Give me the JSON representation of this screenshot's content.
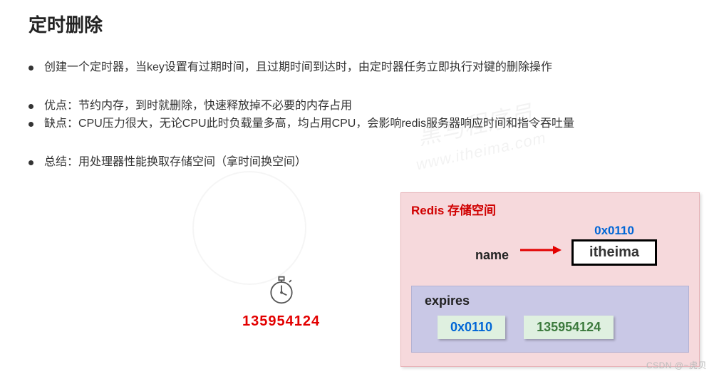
{
  "title": "定时删除",
  "bullets": {
    "b1": "创建一个定时器，当key设置有过期时间，且过期时间到达时，由定时器任务立即执行对键的删除操作",
    "b2": "优点：节约内存，到时就删除，快速释放掉不必要的内存占用",
    "b3": "缺点：CPU压力很大，无论CPU此时负载量多高，均占用CPU，会影响redis服务器响应时间和指令吞吐量",
    "b4": "总结：用处理器性能换取存储空间（拿时间换空间）"
  },
  "watermark": {
    "line1": "黑马程序员",
    "line2": "www.itheima.com"
  },
  "diagram": {
    "timer_value": "135954124",
    "redis_title": "Redis 存储空间",
    "kv_key": "name",
    "kv_addr": "0x0110",
    "kv_value": "itheima",
    "expires_title": "expires",
    "chip_addr": "0x0110",
    "chip_ts": "135954124"
  },
  "footer": "CSDN @~虎贝"
}
